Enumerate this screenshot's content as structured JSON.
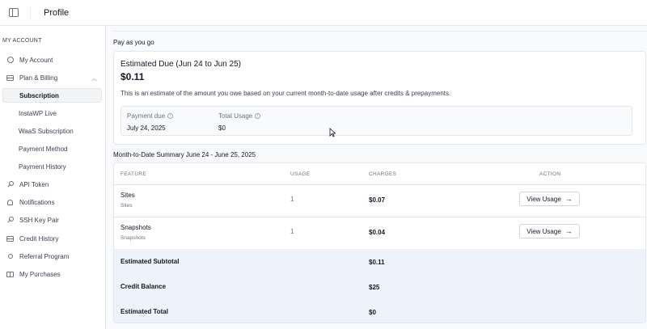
{
  "header": {
    "title": "Profile"
  },
  "sidebar": {
    "section_label": "MY ACCOUNT",
    "items": [
      {
        "label": "My Account",
        "icon": "user-circle-icon"
      },
      {
        "label": "Plan & Billing",
        "icon": "credit-card-icon",
        "expanded": true
      },
      {
        "label": "Subscription",
        "active": true
      },
      {
        "label": "InstaWP Live"
      },
      {
        "label": "WaaS Subscription"
      },
      {
        "label": "Payment Method"
      },
      {
        "label": "Payment History"
      },
      {
        "label": "API Token",
        "icon": "key-icon"
      },
      {
        "label": "Notifications",
        "icon": "bell-icon"
      },
      {
        "label": "SSH Key Pair",
        "icon": "key-icon"
      },
      {
        "label": "Credit History",
        "icon": "credit-card-icon"
      },
      {
        "label": "Referral Program",
        "icon": "people-icon"
      },
      {
        "label": "My Purchases",
        "icon": "gift-icon"
      }
    ]
  },
  "payg": {
    "section_title": "Pay as you go",
    "estimated_due_title": "Estimated Due (Jun 24 to Jun 25)",
    "estimated_due_amount": "$0.11",
    "description": "This is an estimate of the amount you owe based on your current month-to-date usage after credits & prepayments.",
    "payment_due_label": "Payment due",
    "payment_due_value": "July 24, 2025",
    "total_usage_label": "Total Usage",
    "total_usage_value": "$0"
  },
  "summary": {
    "section_title": "Month-to-Date Summary June 24 - June 25, 2025",
    "columns": [
      "FEATURE",
      "USAGE",
      "CHARGES",
      "ACTION"
    ],
    "rows": [
      {
        "name": "Sites",
        "sub": "Sites",
        "usage": "1",
        "charge": "$0.07",
        "action": "View Usage"
      },
      {
        "name": "Snapshots",
        "sub": "Snapshots",
        "usage": "1",
        "charge": "$0.04",
        "action": "View Usage"
      }
    ],
    "totals": [
      {
        "label": "Estimated Subtotal",
        "value": "$0.11"
      },
      {
        "label": "Credit Balance",
        "value": "$25"
      },
      {
        "label": "Estimated Total",
        "value": "$0"
      }
    ]
  },
  "colors": {
    "summary_bg": "#eef3fb",
    "active_bg": "#f3f4f6",
    "border": "#e5e7eb"
  }
}
